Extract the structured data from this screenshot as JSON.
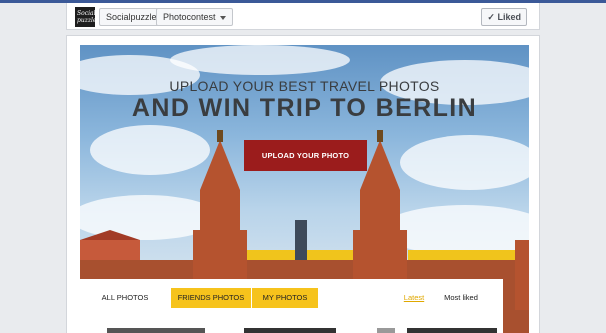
{
  "header": {
    "app_logo_text": "Social puzzle",
    "breadcrumb_app": "Socialpuzzle",
    "breadcrumb_page": "Photocontest",
    "liked_label": "Liked"
  },
  "hero": {
    "subtitle": "UPLOAD YOUR BEST TRAVEL PHOTOS",
    "title": "AND WIN TRIP TO BERLIN",
    "upload_button": "UPLOAD YOUR PHOTO"
  },
  "filter_tabs": {
    "all_photos": "ALL PHOTOS",
    "friends_photos": "FRIENDS PHOTOS",
    "my_photos": "MY PHOTOS",
    "latest": "Latest",
    "most_liked": "Most liked"
  },
  "colors": {
    "accent_yellow": "#f6c31c",
    "button_red": "#9b1c1c",
    "facebook_blue": "#3b5998",
    "brick": "#b5532f"
  }
}
